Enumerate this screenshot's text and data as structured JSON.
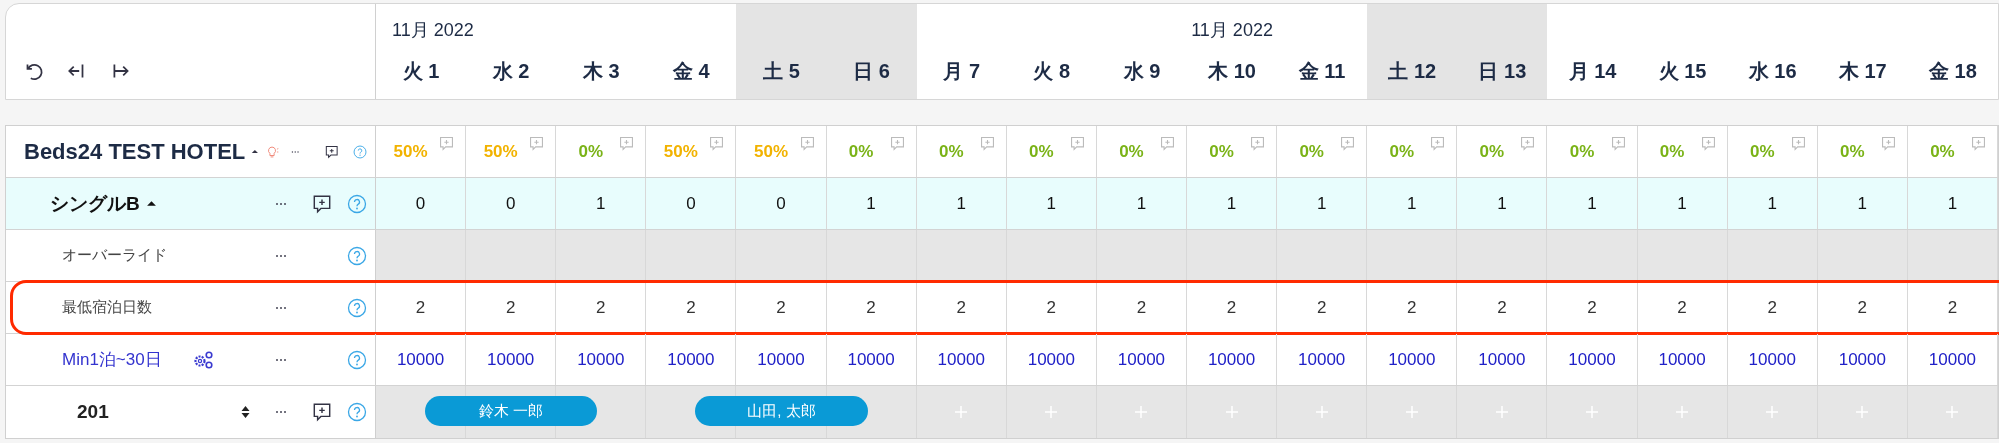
{
  "month_groups": [
    {
      "label": "11月 2022",
      "days": [
        {
          "label": "火 1",
          "weekend": false
        },
        {
          "label": "水 2",
          "weekend": false
        },
        {
          "label": "木 3",
          "weekend": false
        },
        {
          "label": "金 4",
          "weekend": false
        },
        {
          "label": "土 5",
          "weekend": true
        },
        {
          "label": "日 6",
          "weekend": true
        }
      ]
    },
    {
      "label": "11月 2022",
      "days": [
        {
          "label": "月 7",
          "weekend": false
        },
        {
          "label": "火 8",
          "weekend": false
        },
        {
          "label": "水 9",
          "weekend": false
        },
        {
          "label": "木 10",
          "weekend": false
        },
        {
          "label": "金 11",
          "weekend": false
        },
        {
          "label": "土 12",
          "weekend": true
        },
        {
          "label": "日 13",
          "weekend": true
        }
      ]
    },
    {
      "days": [
        {
          "label": "月 14",
          "weekend": false
        },
        {
          "label": "火 15",
          "weekend": false
        },
        {
          "label": "水 16",
          "weekend": false
        },
        {
          "label": "木 17",
          "weekend": false
        },
        {
          "label": "金 18",
          "weekend": false
        }
      ]
    }
  ],
  "property": {
    "name": "Beds24 TEST HOTEL",
    "expanded": true,
    "occupancy": [
      {
        "text": "50%",
        "color": "#f2b300"
      },
      {
        "text": "50%",
        "color": "#f2b300"
      },
      {
        "text": "0%",
        "color": "#7ab317"
      },
      {
        "text": "50%",
        "color": "#f2b300"
      },
      {
        "text": "50%",
        "color": "#f2b300"
      },
      {
        "text": "0%",
        "color": "#7ab317"
      },
      {
        "text": "0%",
        "color": "#7ab317"
      },
      {
        "text": "0%",
        "color": "#7ab317"
      },
      {
        "text": "0%",
        "color": "#7ab317"
      },
      {
        "text": "0%",
        "color": "#7ab317"
      },
      {
        "text": "0%",
        "color": "#7ab317"
      },
      {
        "text": "0%",
        "color": "#7ab317"
      },
      {
        "text": "0%",
        "color": "#7ab317"
      },
      {
        "text": "0%",
        "color": "#7ab317"
      },
      {
        "text": "0%",
        "color": "#7ab317"
      },
      {
        "text": "0%",
        "color": "#7ab317"
      },
      {
        "text": "0%",
        "color": "#7ab317"
      },
      {
        "text": "0%",
        "color": "#7ab317"
      }
    ]
  },
  "room_type": {
    "name": "シングルB",
    "expanded": true,
    "values": [
      "0",
      "0",
      "1",
      "0",
      "0",
      "1",
      "1",
      "1",
      "1",
      "1",
      "1",
      "1",
      "1",
      "1",
      "1",
      "1",
      "1",
      "1"
    ]
  },
  "override": {
    "label": "オーバーライド"
  },
  "min_stay": {
    "label": "最低宿泊日数",
    "highlighted": true,
    "values": [
      "2",
      "2",
      "2",
      "2",
      "2",
      "2",
      "2",
      "2",
      "2",
      "2",
      "2",
      "2",
      "2",
      "2",
      "2",
      "2",
      "2",
      "2"
    ]
  },
  "rate": {
    "label": "Min1泊~30日",
    "values": [
      "10000",
      "10000",
      "10000",
      "10000",
      "10000",
      "10000",
      "10000",
      "10000",
      "10000",
      "10000",
      "10000",
      "10000",
      "10000",
      "10000",
      "10000",
      "10000",
      "10000",
      "10000"
    ]
  },
  "unit": {
    "name": "201",
    "cells": [
      {
        "kind": "checkin",
        "guest": "鈴木 一郎"
      },
      {
        "kind": "stay"
      },
      {
        "kind": "checkout"
      },
      {
        "kind": "checkin",
        "guest": "山田, 太郎"
      },
      {
        "kind": "stay"
      },
      {
        "kind": "checkout"
      },
      {
        "kind": "free"
      },
      {
        "kind": "free"
      },
      {
        "kind": "free"
      },
      {
        "kind": "free"
      },
      {
        "kind": "free"
      },
      {
        "kind": "free"
      },
      {
        "kind": "free"
      },
      {
        "kind": "free"
      },
      {
        "kind": "free"
      },
      {
        "kind": "free"
      },
      {
        "kind": "free"
      },
      {
        "kind": "free"
      }
    ]
  }
}
